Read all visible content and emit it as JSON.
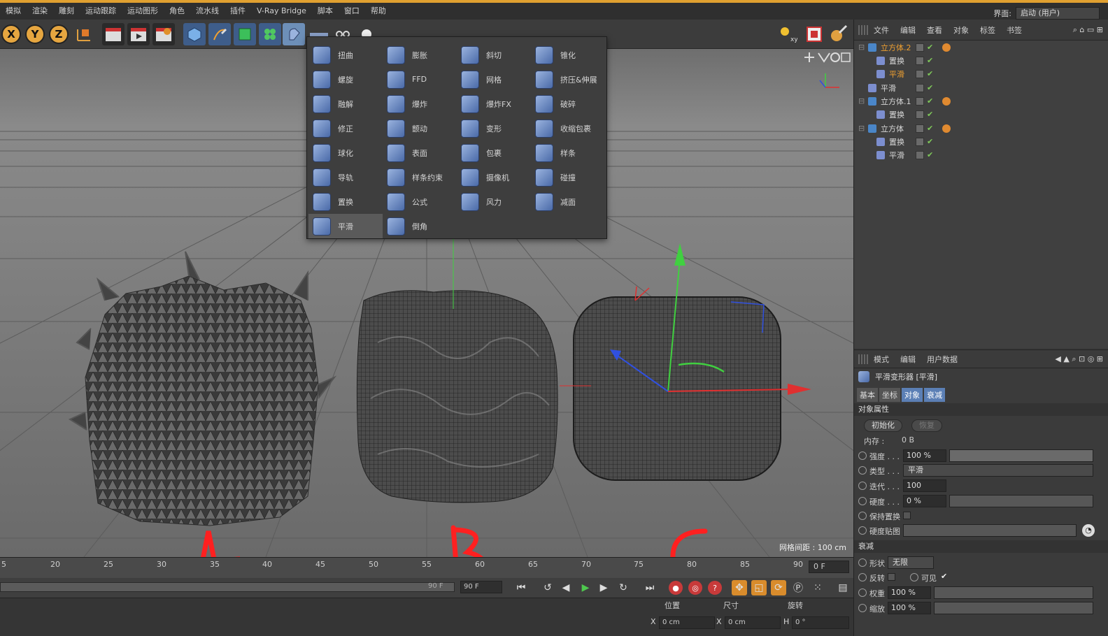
{
  "menubar": {
    "items": [
      "模拟",
      "渲染",
      "雕刻",
      "运动跟踪",
      "运动图形",
      "角色",
      "流水线",
      "插件",
      "V-Ray Bridge",
      "脚本",
      "窗口",
      "帮助"
    ],
    "layout_label": "界面:",
    "layout_value": "启动 (用户)"
  },
  "toolbar": {
    "axis_x": "X",
    "axis_y": "Y",
    "axis_z": "Z"
  },
  "deformer_menu": {
    "items": [
      {
        "label": "扭曲"
      },
      {
        "label": "膨胀"
      },
      {
        "label": "斜切"
      },
      {
        "label": "锥化"
      },
      {
        "label": "螺旋"
      },
      {
        "label": "FFD"
      },
      {
        "label": "网格"
      },
      {
        "label": "挤压&伸展"
      },
      {
        "label": "融解"
      },
      {
        "label": "爆炸"
      },
      {
        "label": "爆炸FX"
      },
      {
        "label": "破碎"
      },
      {
        "label": "修正"
      },
      {
        "label": "颤动"
      },
      {
        "label": "变形"
      },
      {
        "label": "收缩包裹"
      },
      {
        "label": "球化"
      },
      {
        "label": "表面"
      },
      {
        "label": "包裹"
      },
      {
        "label": "样条"
      },
      {
        "label": "导轨"
      },
      {
        "label": "样条约束"
      },
      {
        "label": "摄像机"
      },
      {
        "label": "碰撞"
      },
      {
        "label": "置换"
      },
      {
        "label": "公式"
      },
      {
        "label": "风力"
      },
      {
        "label": "减面"
      },
      {
        "label": "平滑"
      },
      {
        "label": "倒角"
      }
    ],
    "selected": "平滑"
  },
  "viewport": {
    "grid_spacing": "网格间距 : 100 cm",
    "annotations": [
      "A",
      "B",
      "C"
    ]
  },
  "timeline": {
    "ticks": [
      "5",
      "20",
      "25",
      "30",
      "35",
      "40",
      "45",
      "50",
      "55",
      "60",
      "65",
      "70",
      "75",
      "80",
      "85",
      "90"
    ],
    "current_frame": "0 F",
    "end_frame_a": "90 F",
    "end_frame_b": "90 F"
  },
  "coords": {
    "head_position": "位置",
    "head_size": "尺寸",
    "head_rotation": "旋转",
    "x_label": "X",
    "x_pos": "0 cm",
    "x_size_label": "X",
    "x_size": "0 cm",
    "h_label": "H",
    "h_rot": "0 °"
  },
  "object_manager": {
    "menu": [
      "文件",
      "编辑",
      "查看",
      "对象",
      "标签",
      "书签"
    ],
    "rows": [
      {
        "name": "立方体.2",
        "highlight": true,
        "indent": 0
      },
      {
        "name": "置换",
        "highlight": false,
        "indent": 1
      },
      {
        "name": "平滑",
        "highlight": true,
        "indent": 1
      },
      {
        "name": "平滑",
        "highlight": false,
        "indent": 0
      },
      {
        "name": "立方体.1",
        "highlight": false,
        "indent": 0
      },
      {
        "name": "置换",
        "highlight": false,
        "indent": 1
      },
      {
        "name": "立方体",
        "highlight": false,
        "indent": 0
      },
      {
        "name": "置换",
        "highlight": false,
        "indent": 1
      },
      {
        "name": "平滑",
        "highlight": false,
        "indent": 1
      }
    ]
  },
  "attributes": {
    "menu": [
      "模式",
      "编辑",
      "用户数据"
    ],
    "title": "平滑变形器 [平滑]",
    "tabs": [
      "基本",
      "坐标",
      "对象",
      "衰减"
    ],
    "active_tab": "对象",
    "section_object": "对象属性",
    "btn_init": "初始化",
    "btn_restore": "恢复",
    "memory_label": "内存 :",
    "memory_value": "0 B",
    "strength_label": "强度 . . .",
    "strength_value": "100 %",
    "strength_fraction": 1.0,
    "type_label": "类型 . . .",
    "type_value": "平滑",
    "iter_label": "迭代 . . .",
    "iter_value": "100",
    "stiff_label": "硬度 . . .",
    "stiff_value": "0 %",
    "stiff_fraction": 0.0,
    "keep_label": "保持置换",
    "stiffmap_label": "硬度贴图",
    "section_falloff": "衰减",
    "shape_label": "形状",
    "shape_value": "无限",
    "invert_label": "反转",
    "visible_label": "可见",
    "weight_label": "权重",
    "weight_value": "100 %",
    "scale_label": "缩放",
    "scale_value": "100 %"
  }
}
